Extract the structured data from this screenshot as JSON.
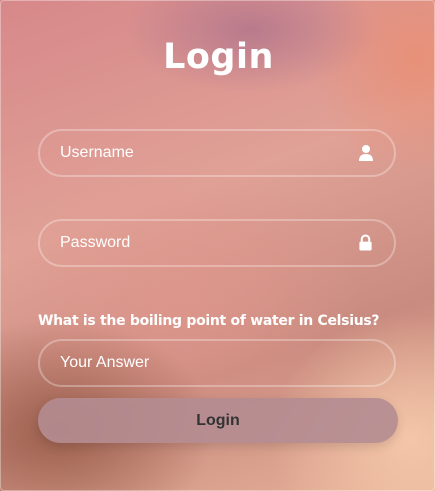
{
  "form": {
    "title": "Login",
    "username": {
      "placeholder": "Username",
      "value": "",
      "icon": "user-icon"
    },
    "password": {
      "placeholder": "Password",
      "value": "",
      "icon": "lock-icon"
    },
    "captcha": {
      "question": "What is the boiling point of water in Celsius?",
      "placeholder": "Your Answer",
      "value": ""
    },
    "submit_label": "Login"
  },
  "colors": {
    "text": "#ffffff",
    "button_bg": "#b48c91",
    "button_text": "#333333"
  }
}
